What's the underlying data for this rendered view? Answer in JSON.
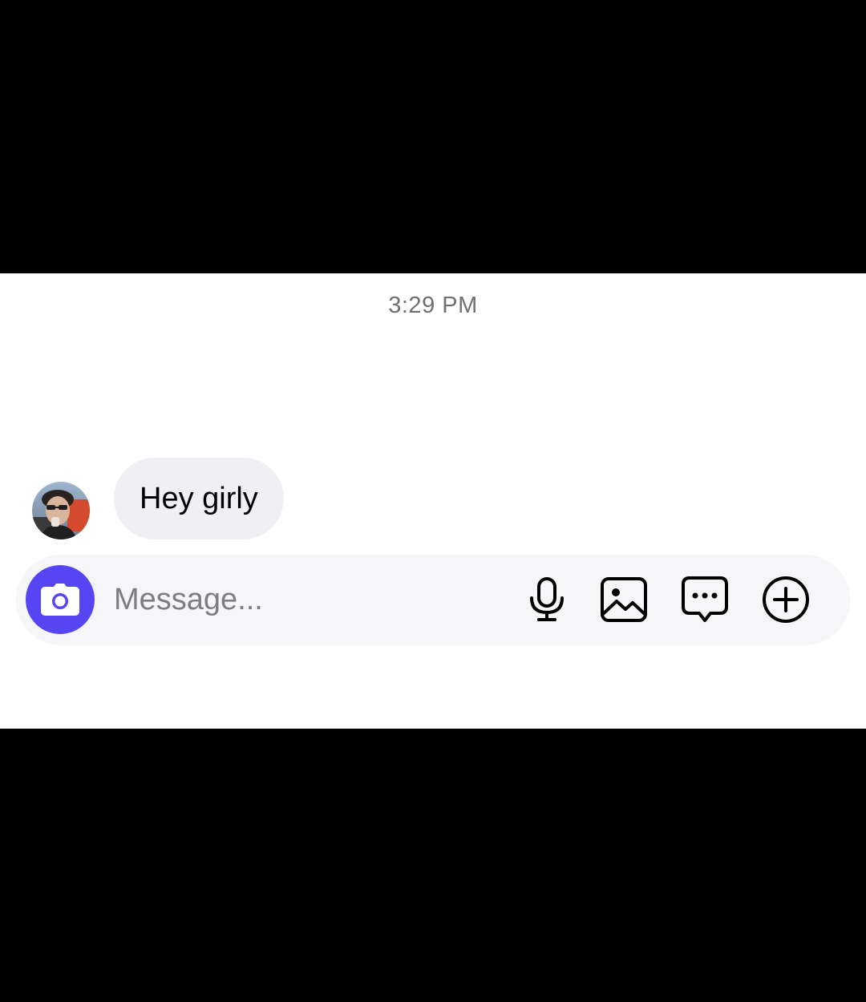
{
  "conversation": {
    "timestamp": "3:29 PM",
    "messages": [
      {
        "sender": "other",
        "text": "Hey girly"
      }
    ]
  },
  "composer": {
    "placeholder": "Message...",
    "value": "",
    "camera_icon": "camera-icon",
    "tools": [
      {
        "name": "microphone-icon"
      },
      {
        "name": "image-icon"
      },
      {
        "name": "chat-bubble-dots-icon"
      },
      {
        "name": "plus-circle-icon"
      }
    ]
  },
  "colors": {
    "accent": "#5645f2",
    "bubble_received": "#efeff4",
    "composer_bg": "#f6f6f8",
    "timestamp_text": "#6f6f74",
    "letterbox": "#000000"
  }
}
